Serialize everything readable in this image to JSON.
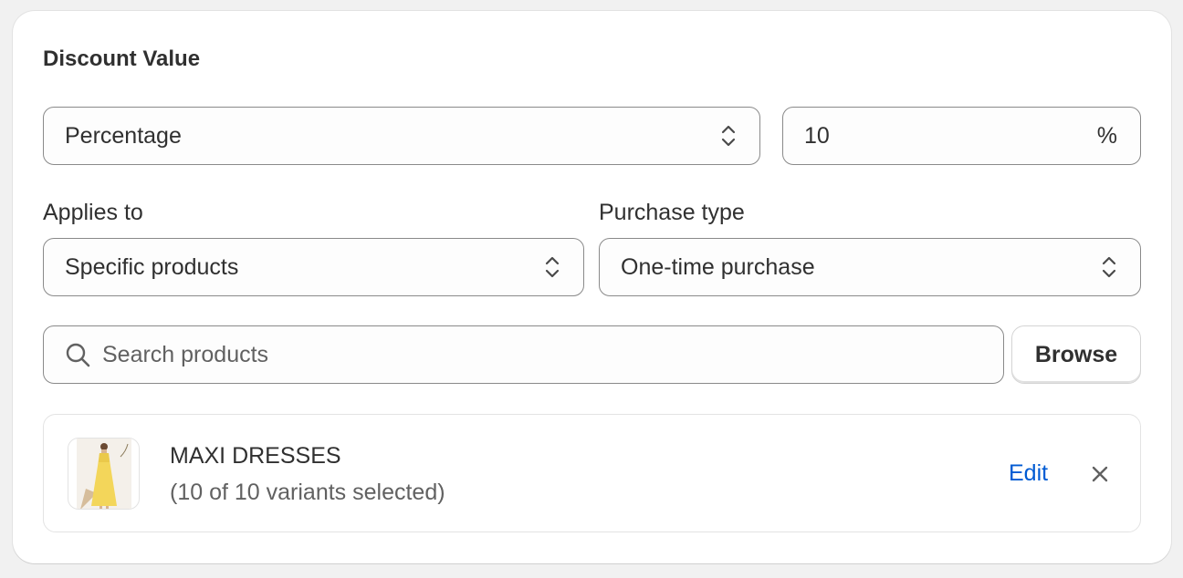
{
  "section": {
    "title": "Discount Value"
  },
  "discount": {
    "type_value": "Percentage",
    "amount_value": "10",
    "amount_suffix": "%"
  },
  "applies_to": {
    "label": "Applies to",
    "value": "Specific products"
  },
  "purchase_type": {
    "label": "Purchase type",
    "value": "One-time purchase"
  },
  "search": {
    "placeholder": "Search products",
    "browse_label": "Browse"
  },
  "product": {
    "name": "MAXI DRESSES",
    "variants": "(10 of 10 variants selected)",
    "edit_label": "Edit",
    "thumbnail_icon": "product-image"
  },
  "colors": {
    "link": "#005bd3",
    "text": "#303030",
    "border": "#8a8a8a",
    "background": "#f1f1f1"
  }
}
